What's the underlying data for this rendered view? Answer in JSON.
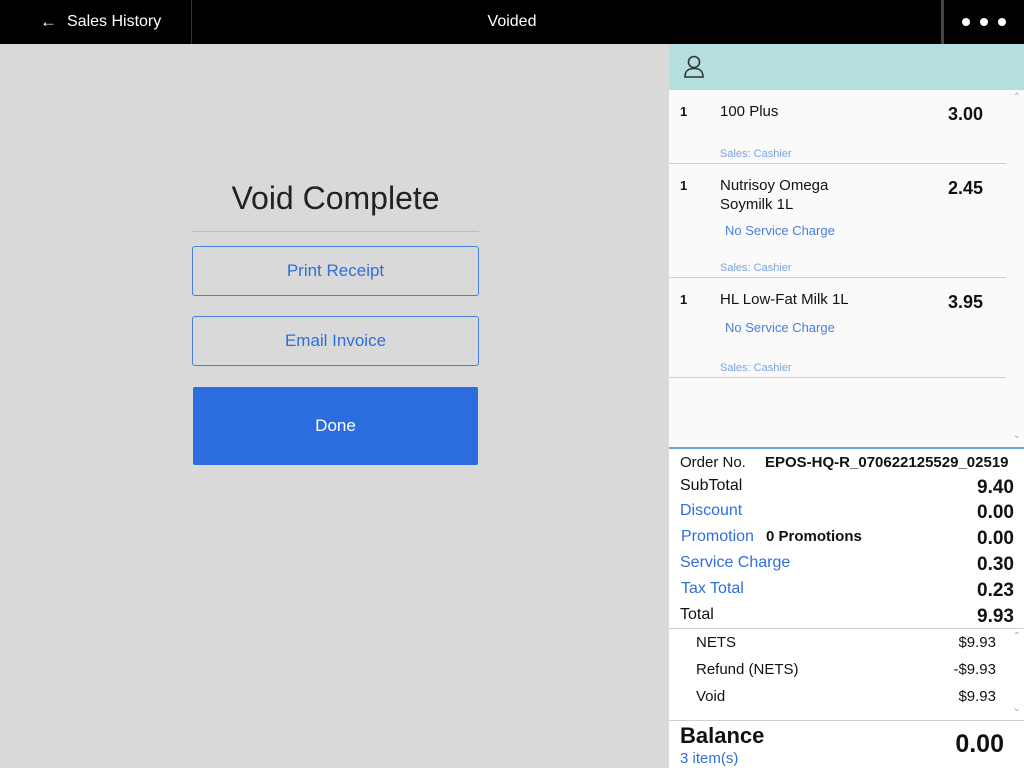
{
  "topbar": {
    "back_label": "Sales History",
    "title": "Voided"
  },
  "main": {
    "heading": "Void Complete",
    "print_receipt_label": "Print Receipt",
    "email_invoice_label": "Email Invoice",
    "done_label": "Done"
  },
  "items": [
    {
      "qty": "1",
      "name": "100 Plus",
      "price": "3.00",
      "modifier": "",
      "sales": "Sales: Cashier"
    },
    {
      "qty": "1",
      "name": "Nutrisoy Omega Soymilk 1L",
      "price": "2.45",
      "modifier": "No Service Charge",
      "sales": "Sales: Cashier"
    },
    {
      "qty": "1",
      "name": "HL Low-Fat Milk 1L",
      "price": "3.95",
      "modifier": "No Service Charge",
      "sales": "Sales: Cashier"
    }
  ],
  "totals": {
    "order_label": "Order No.",
    "order_no": "EPOS-HQ-R_070622125529_02519",
    "subtotal_label": "SubTotal",
    "subtotal": "9.40",
    "discount_label": "Discount",
    "discount": "0.00",
    "promotion_label": "Promotion",
    "promotion_count": "0 Promotions",
    "promotion": "0.00",
    "service_label": "Service Charge",
    "service": "0.30",
    "tax_label": "Tax Total",
    "tax": "0.23",
    "total_label": "Total",
    "total": "9.93"
  },
  "payments": [
    {
      "label": "NETS",
      "value": "$9.93"
    },
    {
      "label": "Refund (NETS)",
      "value": "-$9.93"
    },
    {
      "label": "Void",
      "value": "$9.93"
    }
  ],
  "balance": {
    "label": "Balance",
    "items": "3 item(s)",
    "value": "0.00"
  },
  "colors": {
    "accent": "#2b6ddf",
    "customer_bar": "#b5dede",
    "topbar": "#000000"
  }
}
